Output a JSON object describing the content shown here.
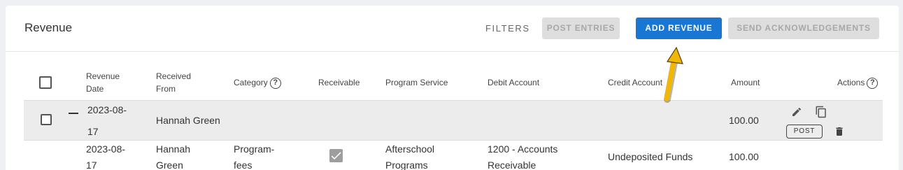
{
  "header": {
    "title": "Revenue",
    "filters_label": "FILTERS",
    "post_entries_label": "POST ENTRIES",
    "add_revenue_label": "ADD REVENUE",
    "send_ack_label": "SEND ACKNOWLEDGEMENTS"
  },
  "table": {
    "columns": {
      "revenue_date_1": "Revenue",
      "revenue_date_2": "Date",
      "received_from_1": "Received",
      "received_from_2": "From",
      "category": "Category",
      "receivable": "Receivable",
      "program_service": "Program Service",
      "debit_account": "Debit Account",
      "credit_account": "Credit Account",
      "amount": "Amount",
      "actions": "Actions"
    },
    "group_row": {
      "date_1": "2023-08-",
      "date_2": "17",
      "received_from": "Hannah Green",
      "amount": "100.00",
      "post_label": "POST"
    },
    "detail_row": {
      "date_1": "2023-08-",
      "date_2": "17",
      "received_from_1": "Hannah",
      "received_from_2": "Green",
      "category_1": "Program-",
      "category_2": "fees",
      "receivable_checked": true,
      "program_service_1": "Afterschool",
      "program_service_2": "Programs",
      "debit_account_1": "1200 - Accounts",
      "debit_account_2": "Receivable",
      "credit_account": "Undeposited Funds",
      "amount": "100.00"
    }
  },
  "icons": {
    "help": "help-circle-icon",
    "edit": "pencil-icon",
    "copy": "copy-icon",
    "delete": "trash-icon",
    "collapse": "minus-icon",
    "annotation": "arrow-icon"
  },
  "colors": {
    "primary": "#1976d2",
    "arrow": "#f2b705",
    "disabled_bg": "#dedede"
  }
}
